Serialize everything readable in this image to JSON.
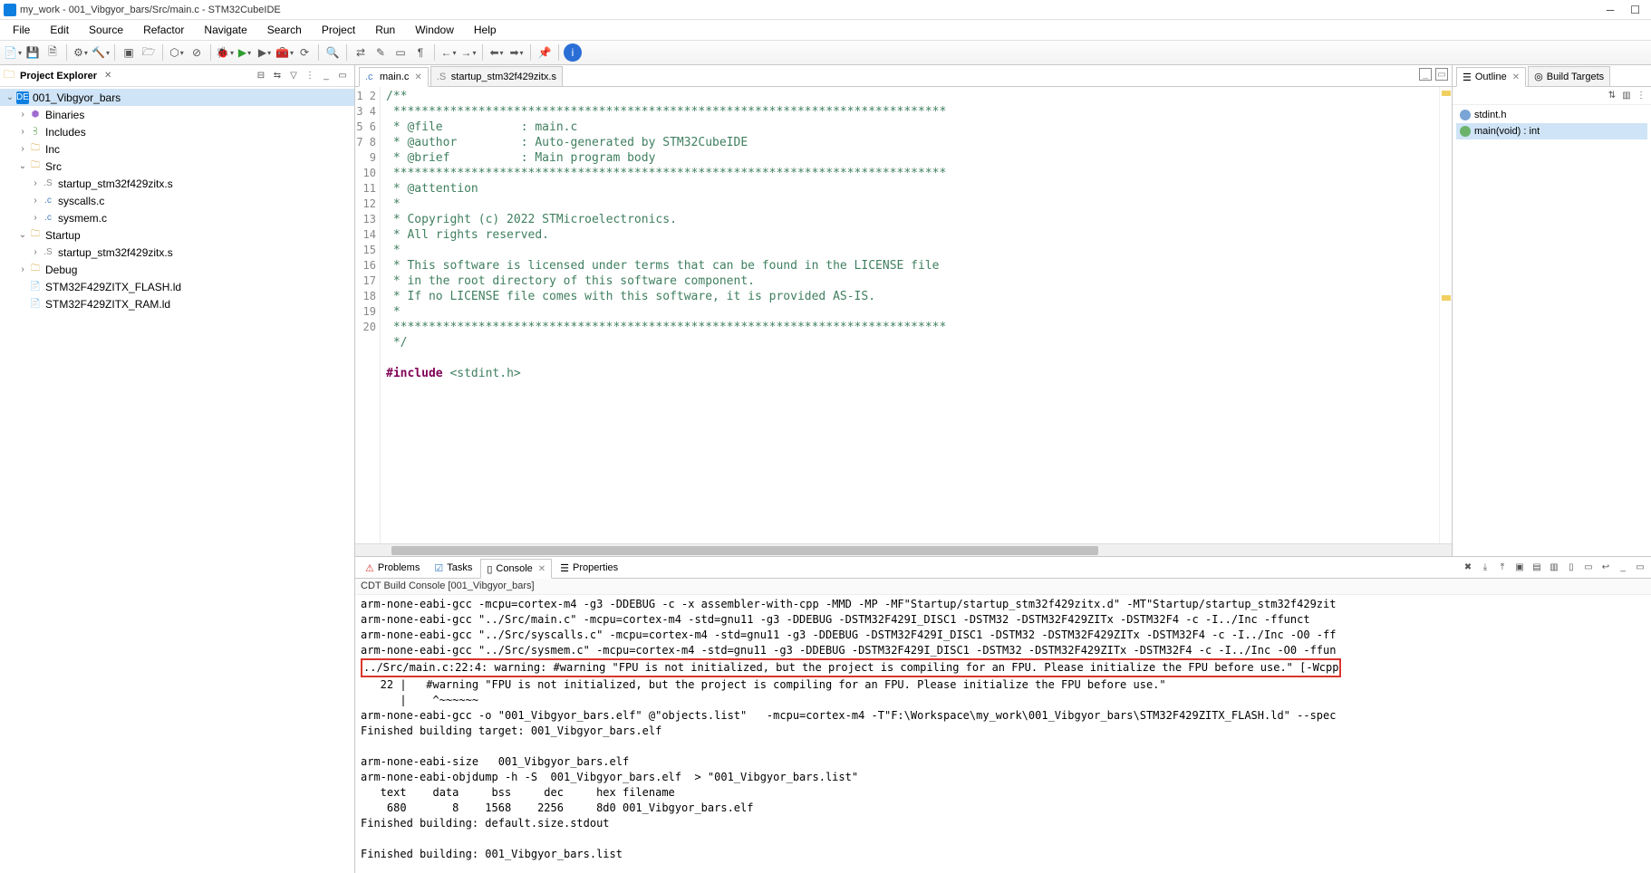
{
  "title": "my_work - 001_Vibgyor_bars/Src/main.c - STM32CubeIDE",
  "menus": [
    "File",
    "Edit",
    "Source",
    "Refactor",
    "Navigate",
    "Search",
    "Project",
    "Run",
    "Window",
    "Help"
  ],
  "explorer": {
    "title": "Project Explorer",
    "root": "001_Vibgyor_bars",
    "items": {
      "binaries": "Binaries",
      "includes": "Includes",
      "inc": "Inc",
      "src": "Src",
      "src_startup": "startup_stm32f429zitx.s",
      "src_syscalls": "syscalls.c",
      "src_sysmem": "sysmem.c",
      "startup": "Startup",
      "startup_file": "startup_stm32f429zitx.s",
      "debug": "Debug",
      "flash_ld": "STM32F429ZITX_FLASH.ld",
      "ram_ld": "STM32F429ZITX_RAM.ld"
    }
  },
  "editor": {
    "tabs": {
      "main": "main.c",
      "startup": "startup_stm32f429zitx.s"
    },
    "lines": [
      "/**",
      " ******************************************************************************",
      " * @file           : main.c",
      " * @author         : Auto-generated by STM32CubeIDE",
      " * @brief          : Main program body",
      " ******************************************************************************",
      " * @attention",
      " *",
      " * Copyright (c) 2022 STMicroelectronics.",
      " * All rights reserved.",
      " *",
      " * This software is licensed under terms that can be found in the LICENSE file",
      " * in the root directory of this software component.",
      " * If no LICENSE file comes with this software, it is provided AS-IS.",
      " *",
      " ******************************************************************************",
      " */",
      ""
    ],
    "include_kw": "#include",
    "include_hdr": "<stdint.h>"
  },
  "outline": {
    "tabs": {
      "outline": "Outline",
      "build": "Build Targets"
    },
    "items": {
      "stdint": "stdint.h",
      "main": "main(void) : int"
    }
  },
  "bottom": {
    "tabs": {
      "problems": "Problems",
      "tasks": "Tasks",
      "console": "Console",
      "properties": "Properties"
    },
    "console_title": "CDT Build Console [001_Vibgyor_bars]",
    "lines": {
      "l0": "arm-none-eabi-gcc -mcpu=cortex-m4 -g3 -DDEBUG -c -x assembler-with-cpp -MMD -MP -MF\"Startup/startup_stm32f429zitx.d\" -MT\"Startup/startup_stm32f429zit",
      "l1": "arm-none-eabi-gcc \"../Src/main.c\" -mcpu=cortex-m4 -std=gnu11 -g3 -DDEBUG -DSTM32F429I_DISC1 -DSTM32 -DSTM32F429ZITx -DSTM32F4 -c -I../Inc -ffunct",
      "l2": "arm-none-eabi-gcc \"../Src/syscalls.c\" -mcpu=cortex-m4 -std=gnu11 -g3 -DDEBUG -DSTM32F429I_DISC1 -DSTM32 -DSTM32F429ZITx -DSTM32F4 -c -I../Inc -O0 -ff",
      "l3": "arm-none-eabi-gcc \"../Src/sysmem.c\" -mcpu=cortex-m4 -std=gnu11 -g3 -DDEBUG -DSTM32F429I_DISC1 -DSTM32 -DSTM32F429ZITx -DSTM32F4 -c -I../Inc -O0 -ffun",
      "hl": "../Src/main.c:22:4: warning: #warning \"FPU is not initialized, but the project is compiling for an FPU. Please initialize the FPU before use.\" [-Wcpp",
      "l5": "   22 |   #warning \"FPU is not initialized, but the project is compiling for an FPU. Please initialize the FPU before use.\"",
      "l6": "      |    ^~~~~~~",
      "l7": "arm-none-eabi-gcc -o \"001_Vibgyor_bars.elf\" @\"objects.list\"   -mcpu=cortex-m4 -T\"F:\\Workspace\\my_work\\001_Vibgyor_bars\\STM32F429ZITX_FLASH.ld\" --spec",
      "l8": "Finished building target: 001_Vibgyor_bars.elf",
      "l9": " ",
      "l10": "arm-none-eabi-size   001_Vibgyor_bars.elf",
      "l11": "arm-none-eabi-objdump -h -S  001_Vibgyor_bars.elf  > \"001_Vibgyor_bars.list\"",
      "l12": "   text    data     bss     dec     hex filename",
      "l13": "    680       8    1568    2256     8d0 001_Vibgyor_bars.elf",
      "l14": "Finished building: default.size.stdout",
      "l15": " ",
      "l16": "Finished building: 001_Vibgyor_bars.list"
    }
  }
}
